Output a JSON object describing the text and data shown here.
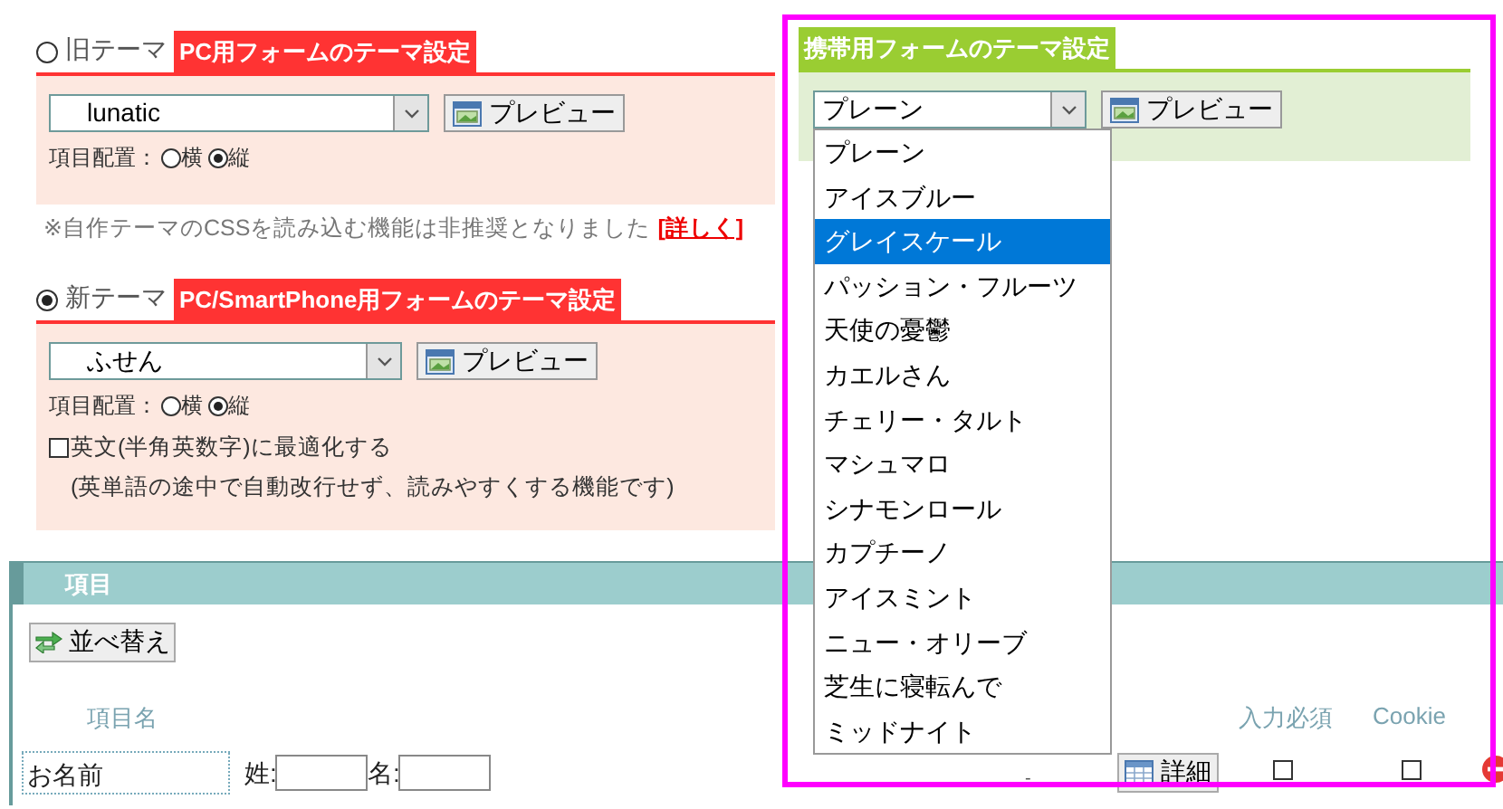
{
  "old_theme": {
    "radio_label": "旧テーマ",
    "selected": false,
    "tag": "PC用フォームのテーマ設定",
    "select_value": "lunatic",
    "preview_button": "プレビュー",
    "layout_label": "項目配置：",
    "layout_options": [
      {
        "label": "横",
        "selected": false
      },
      {
        "label": "縦",
        "selected": true
      }
    ]
  },
  "notice": {
    "text": "※自作テーマのCSSを読み込む機能は非推奨となりました",
    "link": "[詳しく]"
  },
  "new_theme": {
    "radio_label": "新テーマ",
    "selected": true,
    "tag": "PC/SmartPhone用フォームのテーマ設定",
    "select_value": "ふせん",
    "preview_button": "プレビュー",
    "layout_label": "項目配置：",
    "layout_options": [
      {
        "label": "横",
        "selected": false
      },
      {
        "label": "縦",
        "selected": true
      }
    ],
    "optimize": {
      "label": "英文(半角英数字)に最適化する",
      "checked": false,
      "note": "(英単語の途中で自動改行せず、読みやすくする機能です)"
    }
  },
  "mobile_theme": {
    "highlighted": true,
    "tag": "携帯用フォームのテーマ設定",
    "select_value": "プレーン",
    "preview_button": "プレビュー",
    "expanded": true,
    "options": [
      {
        "label": "プレーン",
        "selected": false
      },
      {
        "label": "アイスブルー",
        "selected": false
      },
      {
        "label": "グレイスケール",
        "selected": true
      },
      {
        "label": "パッション・フルーツ",
        "selected": false
      },
      {
        "label": "天使の憂鬱",
        "selected": false
      },
      {
        "label": "カエルさん",
        "selected": false
      },
      {
        "label": "チェリー・タルト",
        "selected": false
      },
      {
        "label": "マシュマロ",
        "selected": false
      },
      {
        "label": "シナモンロール",
        "selected": false
      },
      {
        "label": "カプチーノ",
        "selected": false
      },
      {
        "label": "アイスミント",
        "selected": false
      },
      {
        "label": "ニュー・オリーブ",
        "selected": false
      },
      {
        "label": "芝生に寝転んで",
        "selected": false
      },
      {
        "label": "ミッドナイト",
        "selected": false
      }
    ]
  },
  "items_section": {
    "title": "項目",
    "sort_button": "並べ替え",
    "columns": [
      "項目名",
      "入力必須",
      "Cookie"
    ],
    "rows": [
      {
        "name": "お名前",
        "fields": [
          "姓:",
          "名:"
        ],
        "column_3": "-",
        "detail_button": "詳細",
        "required": false,
        "cookie": false
      }
    ]
  }
}
